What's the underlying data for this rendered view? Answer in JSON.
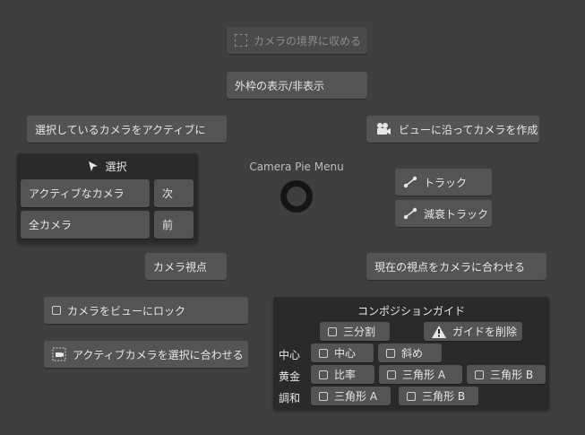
{
  "pie_title": "Camera Pie Menu",
  "items": {
    "fit_bounds": "カメラの境界に収める",
    "toggle_frame": "外枠の表示/非表示",
    "set_active": "選択しているカメラをアクティブに",
    "create_from_view": "ビューに沿ってカメラを作成",
    "track": "トラック",
    "damped_track": "減衰トラック",
    "camera_view": "カメラ視点",
    "align_to_view": "現在の視点をカメラに合わせる",
    "lock_to_view": "カメラをビューにロック",
    "fit_active_to_selected": "アクティブカメラを選択に合わせる"
  },
  "select_panel": {
    "title": "選択",
    "active_camera": "アクティブなカメラ",
    "next": "次",
    "all_cameras": "全カメラ",
    "prev": "前"
  },
  "composition": {
    "title": "コンポジションガイド",
    "thirds": "三分割",
    "delete_guides": "ガイドを削除",
    "center_label": "中心",
    "center": "中心",
    "diagonal": "斜め",
    "golden_label": "黄金",
    "ratio": "比率",
    "golden_triangle_a": "三角形 A",
    "golden_triangle_b": "三角形 B",
    "harmony_label": "調和",
    "harmony_triangle_a": "三角形 A",
    "harmony_triangle_b": "三角形 B"
  }
}
